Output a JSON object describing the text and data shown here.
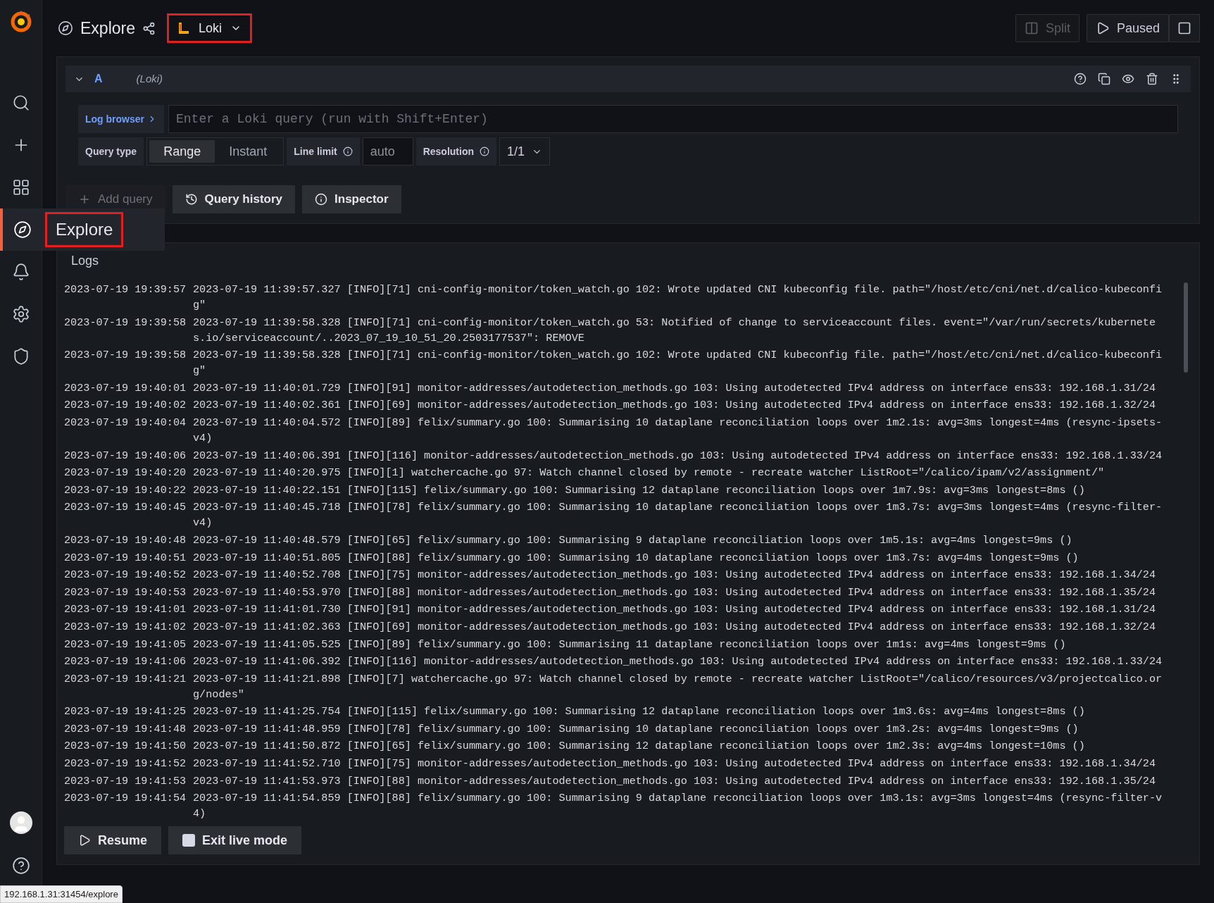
{
  "sidebar": {
    "items": [
      {
        "selected": false
      },
      {
        "selected": false
      },
      {
        "selected": false
      },
      {
        "selected": true
      },
      {
        "selected": false
      },
      {
        "selected": false
      },
      {
        "selected": false
      }
    ],
    "tooltip": "Explore"
  },
  "topbar": {
    "title": "Explore",
    "datasource": "Loki",
    "buttons": [
      {
        "label": "Split",
        "disabled": true
      },
      {
        "label": "Paused",
        "disabled": false
      }
    ]
  },
  "query": {
    "letter": "A",
    "source": "(Loki)",
    "log_browser": "Log browser",
    "placeholder": "Enter a Loki query (run with Shift+Enter)",
    "query_type_label": "Query type",
    "query_types": [
      {
        "label": "Range",
        "selected": true
      },
      {
        "label": "Instant",
        "selected": false
      }
    ],
    "line_limit_label": "Line limit",
    "line_limit_placeholder": "auto",
    "resolution_label": "Resolution",
    "resolution_value": "1/1"
  },
  "actions": [
    {
      "label": "Add query",
      "disabled": true
    },
    {
      "label": "Query history",
      "disabled": false
    },
    {
      "label": "Inspector",
      "disabled": false
    }
  ],
  "logs": {
    "title": "Logs",
    "rows": [
      {
        "time": "2023-07-19 19:39:57",
        "line": "2023-07-19 11:39:57.327 [INFO][71] cni-config-monitor/token_watch.go 102: Wrote updated CNI kubeconfig file. path=\"/host/etc/cni/net.d/calico-kubeconfig\""
      },
      {
        "time": "2023-07-19 19:39:58",
        "line": "2023-07-19 11:39:58.328 [INFO][71] cni-config-monitor/token_watch.go 53: Notified of change to serviceaccount files. event=\"/var/run/secrets/kubernetes.io/serviceaccount/..2023_07_19_10_51_20.2503177537\": REMOVE"
      },
      {
        "time": "2023-07-19 19:39:58",
        "line": "2023-07-19 11:39:58.328 [INFO][71] cni-config-monitor/token_watch.go 102: Wrote updated CNI kubeconfig file. path=\"/host/etc/cni/net.d/calico-kubeconfig\""
      },
      {
        "time": "2023-07-19 19:40:01",
        "line": "2023-07-19 11:40:01.729 [INFO][91] monitor-addresses/autodetection_methods.go 103: Using autodetected IPv4 address on interface ens33: 192.168.1.31/24"
      },
      {
        "time": "2023-07-19 19:40:02",
        "line": "2023-07-19 11:40:02.361 [INFO][69] monitor-addresses/autodetection_methods.go 103: Using autodetected IPv4 address on interface ens33: 192.168.1.32/24"
      },
      {
        "time": "2023-07-19 19:40:04",
        "line": "2023-07-19 11:40:04.572 [INFO][89] felix/summary.go 100: Summarising 10 dataplane reconciliation loops over 1m2.1s: avg=3ms longest=4ms (resync-ipsets-v4)"
      },
      {
        "time": "2023-07-19 19:40:06",
        "line": "2023-07-19 11:40:06.391 [INFO][116] monitor-addresses/autodetection_methods.go 103: Using autodetected IPv4 address on interface ens33: 192.168.1.33/24"
      },
      {
        "time": "2023-07-19 19:40:20",
        "line": "2023-07-19 11:40:20.975 [INFO][1] watchercache.go 97: Watch channel closed by remote - recreate watcher ListRoot=\"/calico/ipam/v2/assignment/\""
      },
      {
        "time": "2023-07-19 19:40:22",
        "line": "2023-07-19 11:40:22.151 [INFO][115] felix/summary.go 100: Summarising 12 dataplane reconciliation loops over 1m7.9s: avg=3ms longest=8ms ()"
      },
      {
        "time": "2023-07-19 19:40:45",
        "line": "2023-07-19 11:40:45.718 [INFO][78] felix/summary.go 100: Summarising 10 dataplane reconciliation loops over 1m3.7s: avg=3ms longest=4ms (resync-filter-v4)"
      },
      {
        "time": "2023-07-19 19:40:48",
        "line": "2023-07-19 11:40:48.579 [INFO][65] felix/summary.go 100: Summarising 9 dataplane reconciliation loops over 1m5.1s: avg=4ms longest=9ms ()"
      },
      {
        "time": "2023-07-19 19:40:51",
        "line": "2023-07-19 11:40:51.805 [INFO][88] felix/summary.go 100: Summarising 10 dataplane reconciliation loops over 1m3.7s: avg=4ms longest=9ms ()"
      },
      {
        "time": "2023-07-19 19:40:52",
        "line": "2023-07-19 11:40:52.708 [INFO][75] monitor-addresses/autodetection_methods.go 103: Using autodetected IPv4 address on interface ens33: 192.168.1.34/24"
      },
      {
        "time": "2023-07-19 19:40:53",
        "line": "2023-07-19 11:40:53.970 [INFO][88] monitor-addresses/autodetection_methods.go 103: Using autodetected IPv4 address on interface ens33: 192.168.1.35/24"
      },
      {
        "time": "2023-07-19 19:41:01",
        "line": "2023-07-19 11:41:01.730 [INFO][91] monitor-addresses/autodetection_methods.go 103: Using autodetected IPv4 address on interface ens33: 192.168.1.31/24"
      },
      {
        "time": "2023-07-19 19:41:02",
        "line": "2023-07-19 11:41:02.363 [INFO][69] monitor-addresses/autodetection_methods.go 103: Using autodetected IPv4 address on interface ens33: 192.168.1.32/24"
      },
      {
        "time": "2023-07-19 19:41:05",
        "line": "2023-07-19 11:41:05.525 [INFO][89] felix/summary.go 100: Summarising 11 dataplane reconciliation loops over 1m1s: avg=4ms longest=9ms ()"
      },
      {
        "time": "2023-07-19 19:41:06",
        "line": "2023-07-19 11:41:06.392 [INFO][116] monitor-addresses/autodetection_methods.go 103: Using autodetected IPv4 address on interface ens33: 192.168.1.33/24"
      },
      {
        "time": "2023-07-19 19:41:21",
        "line": "2023-07-19 11:41:21.898 [INFO][7] watchercache.go 97: Watch channel closed by remote - recreate watcher ListRoot=\"/calico/resources/v3/projectcalico.org/nodes\""
      },
      {
        "time": "2023-07-19 19:41:25",
        "line": "2023-07-19 11:41:25.754 [INFO][115] felix/summary.go 100: Summarising 12 dataplane reconciliation loops over 1m3.6s: avg=4ms longest=8ms ()"
      },
      {
        "time": "2023-07-19 19:41:48",
        "line": "2023-07-19 11:41:48.959 [INFO][78] felix/summary.go 100: Summarising 10 dataplane reconciliation loops over 1m3.2s: avg=4ms longest=9ms ()"
      },
      {
        "time": "2023-07-19 19:41:50",
        "line": "2023-07-19 11:41:50.872 [INFO][65] felix/summary.go 100: Summarising 12 dataplane reconciliation loops over 1m2.3s: avg=4ms longest=10ms ()"
      },
      {
        "time": "2023-07-19 19:41:52",
        "line": "2023-07-19 11:41:52.710 [INFO][75] monitor-addresses/autodetection_methods.go 103: Using autodetected IPv4 address on interface ens33: 192.168.1.34/24"
      },
      {
        "time": "2023-07-19 19:41:53",
        "line": "2023-07-19 11:41:53.973 [INFO][88] monitor-addresses/autodetection_methods.go 103: Using autodetected IPv4 address on interface ens33: 192.168.1.35/24"
      },
      {
        "time": "2023-07-19 19:41:54",
        "line": "2023-07-19 11:41:54.859 [INFO][88] felix/summary.go 100: Summarising 9 dataplane reconciliation loops over 1m3.1s: avg=3ms longest=4ms (resync-filter-v4)"
      }
    ],
    "buttons": [
      "Resume",
      "Exit live mode"
    ]
  },
  "status_url": "192.168.1.31:31454/explore"
}
